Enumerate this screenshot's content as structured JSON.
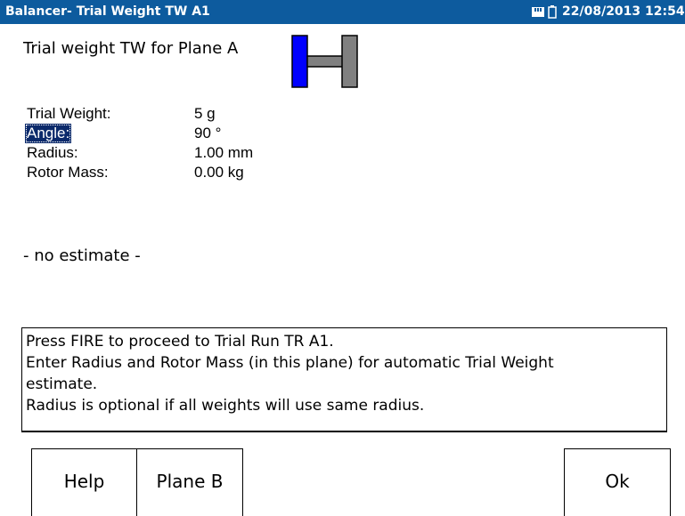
{
  "window": {
    "title": "Balancer- Trial Weight TW A1",
    "datetime": "22/08/2013 12:54",
    "memory_icon": "memory-card-icon",
    "battery_icon": "battery-icon"
  },
  "header": {
    "heading": "Trial weight TW for Plane A",
    "rotor_icon": "rotor-plane-a-icon"
  },
  "params": [
    {
      "label": "Trial Weight:",
      "value": "5 g"
    },
    {
      "label": "Angle:",
      "value": "90 °"
    },
    {
      "label": "Radius:",
      "value": "1.00 mm"
    },
    {
      "label": "Rotor Mass:",
      "value": "0.00 kg"
    }
  ],
  "estimate": "- no estimate -",
  "message": {
    "lines": [
      "Press FIRE to proceed to Trial Run TR A1.",
      "Enter Radius and Rotor Mass (in this plane) for automatic Trial Weight",
      "estimate.",
      "Radius is optional if all weights will use same radius."
    ]
  },
  "buttons": {
    "help": "Help",
    "plane_b": "Plane B",
    "ok": "Ok"
  },
  "colors": {
    "titlebar": "#0d5b9e",
    "selection": "#0b2a6b",
    "rotor_active_plane": "#0000ff",
    "rotor_inactive_plane": "#808080"
  }
}
